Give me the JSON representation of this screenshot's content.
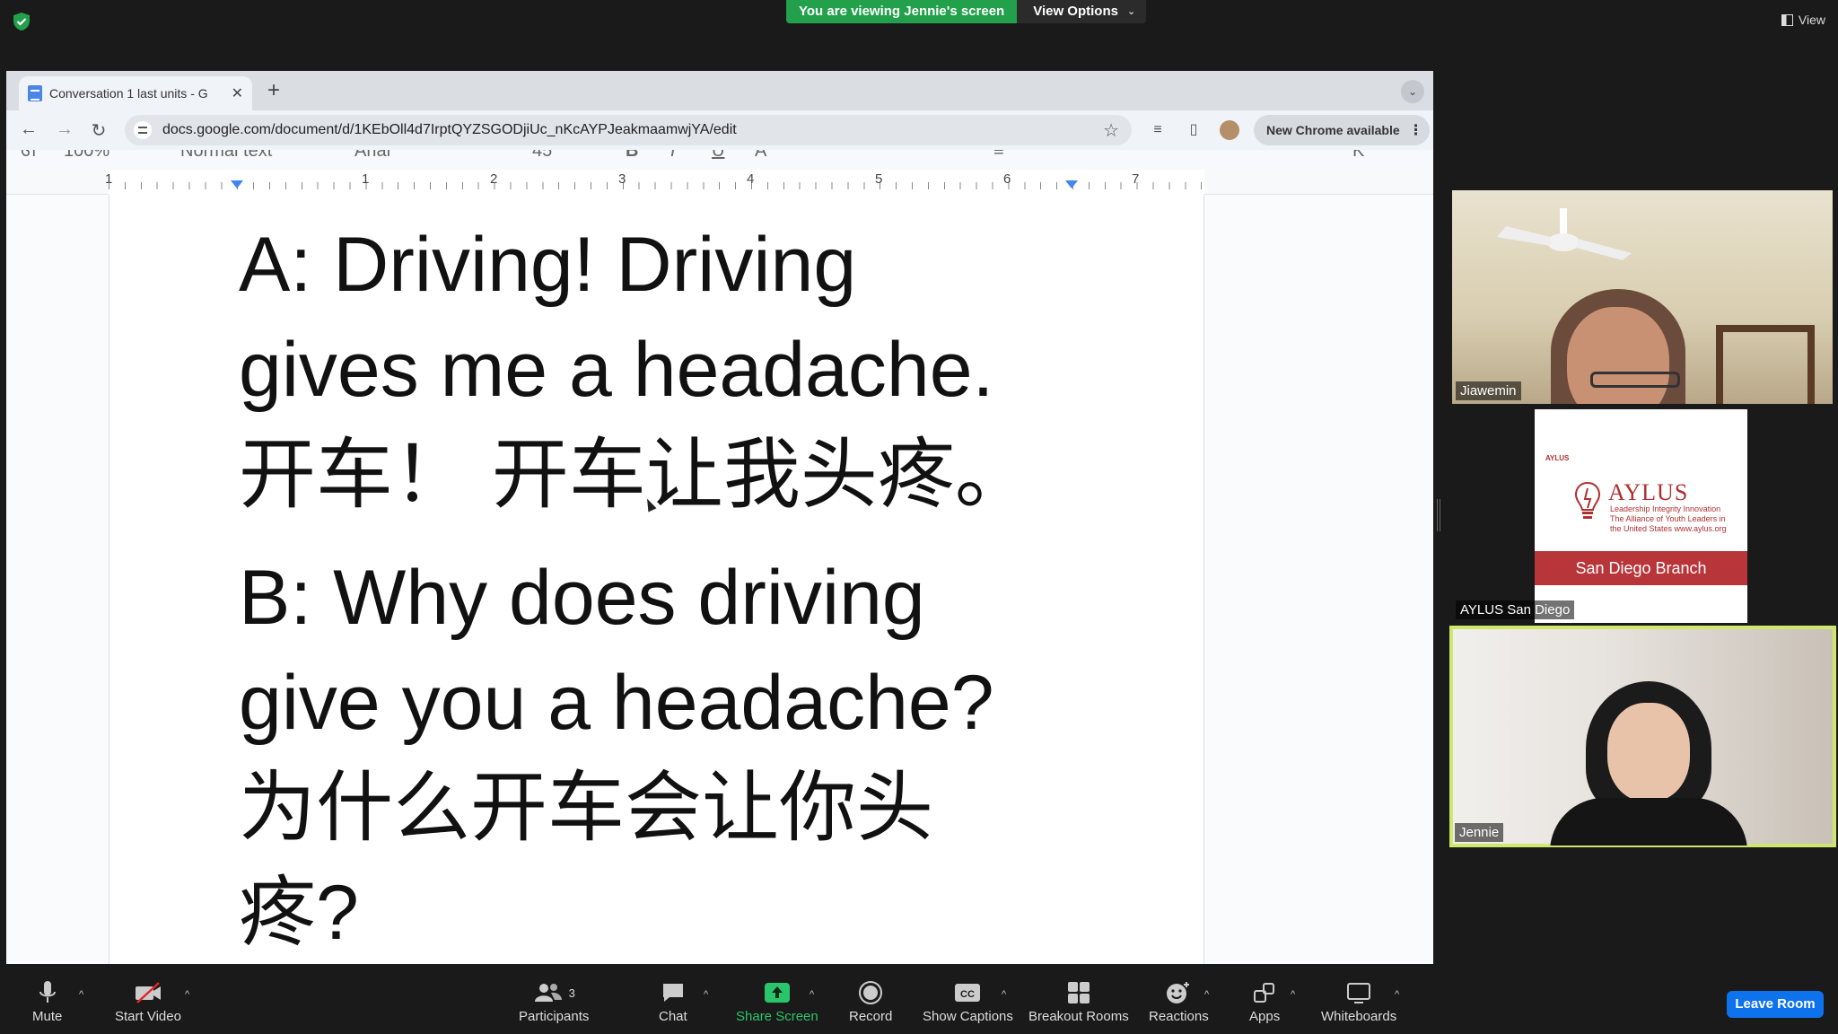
{
  "zoom_banner": {
    "viewing_label": "You are viewing Jennie's screen",
    "view_options_label": "View Options",
    "view_label": "View"
  },
  "browser": {
    "tab_title": "Conversation 1 last units - G",
    "url": "docs.google.com/document/d/1KEbOll4d7IrptQYZSGODjiUc_nKcAYPJeakmaamwjYA/edit",
    "new_chrome_label": "New Chrome available"
  },
  "docs_toolbar": {
    "zoom": "100%",
    "style": "Normal text",
    "font": "Arial",
    "font_size": "45"
  },
  "ruler": {
    "numbers": [
      "1",
      "1",
      "2",
      "3",
      "4",
      "5",
      "6",
      "7"
    ]
  },
  "document": {
    "lines_a": [
      "A: Driving! Driving",
      "gives me a headache.",
      "开车！ 开车让我头疼。"
    ],
    "lines_b": [
      "B: Why does driving",
      "give you a headache?",
      "为什么开车会让你头",
      "疼?"
    ]
  },
  "participants": [
    {
      "name": "Jiawemin"
    },
    {
      "name": "AYLUS San Diego",
      "logo": {
        "small": "AYLUS",
        "title": "AYLUS",
        "subtitle": "Leadership Integrity Innovation The Alliance of Youth Leaders in the United States www.aylus.org",
        "branch": "San Diego Branch"
      }
    },
    {
      "name": "Jennie"
    }
  ],
  "controls": {
    "mute": "Mute",
    "start_video": "Start Video",
    "participants": "Participants",
    "participants_count": "3",
    "chat": "Chat",
    "share_screen": "Share Screen",
    "record": "Record",
    "show_captions": "Show Captions",
    "breakout_rooms": "Breakout Rooms",
    "reactions": "Reactions",
    "apps": "Apps",
    "whiteboards": "Whiteboards",
    "leave": "Leave Room"
  },
  "colors": {
    "zoom_green": "#22a04b",
    "leave_blue": "#0e72ed",
    "active_speaker": "#cde86d",
    "aylus_red": "#b8353a"
  }
}
